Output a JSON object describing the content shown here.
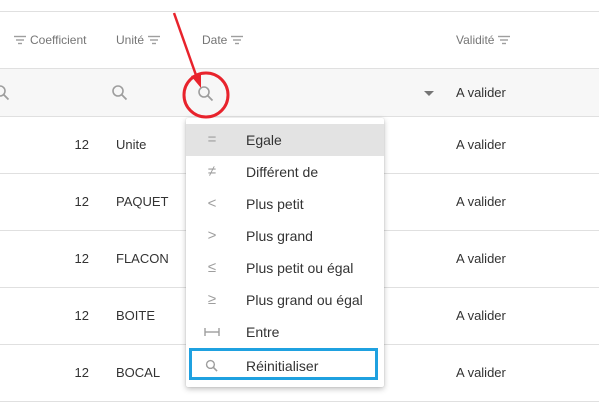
{
  "header": {
    "coefficient": "Coefficient",
    "unite": "Unité",
    "date": "Date",
    "validite": "Validité"
  },
  "filter_row": {
    "validite_value": "A valider"
  },
  "rows": [
    {
      "coefficient": "12",
      "unite": "Unite",
      "validite": "A valider"
    },
    {
      "coefficient": "12",
      "unite": "PAQUET",
      "validite": "A valider"
    },
    {
      "coefficient": "12",
      "unite": "FLACON",
      "validite": "A valider"
    },
    {
      "coefficient": "12",
      "unite": "BOITE",
      "validite": "A valider"
    },
    {
      "coefficient": "12",
      "unite": "BOCAL",
      "validite": "A valider"
    }
  ],
  "menu": {
    "items": [
      {
        "label": "Egale",
        "glyph": "=",
        "icon": "equals-icon",
        "selected": true
      },
      {
        "label": "Différent de",
        "glyph": "≠",
        "icon": "not-equal-icon",
        "selected": false
      },
      {
        "label": "Plus petit",
        "glyph": "<",
        "icon": "less-than-icon",
        "selected": false
      },
      {
        "label": "Plus grand",
        "glyph": ">",
        "icon": "greater-than-icon",
        "selected": false
      },
      {
        "label": "Plus petit ou égal",
        "glyph": "≤",
        "icon": "less-or-equal-icon",
        "selected": false
      },
      {
        "label": "Plus grand ou égal",
        "glyph": "≥",
        "icon": "greater-or-equal-icon",
        "selected": false
      },
      {
        "label": "Entre",
        "glyph": "↔",
        "icon": "between-icon",
        "selected": false
      },
      {
        "label": "Réinitialiser",
        "glyph": "",
        "icon": "search-icon",
        "selected": false
      }
    ]
  },
  "colors": {
    "annotation_red": "#e8232c",
    "highlight_blue": "#1fa1e0",
    "selected_bg": "#e3e3e3"
  }
}
